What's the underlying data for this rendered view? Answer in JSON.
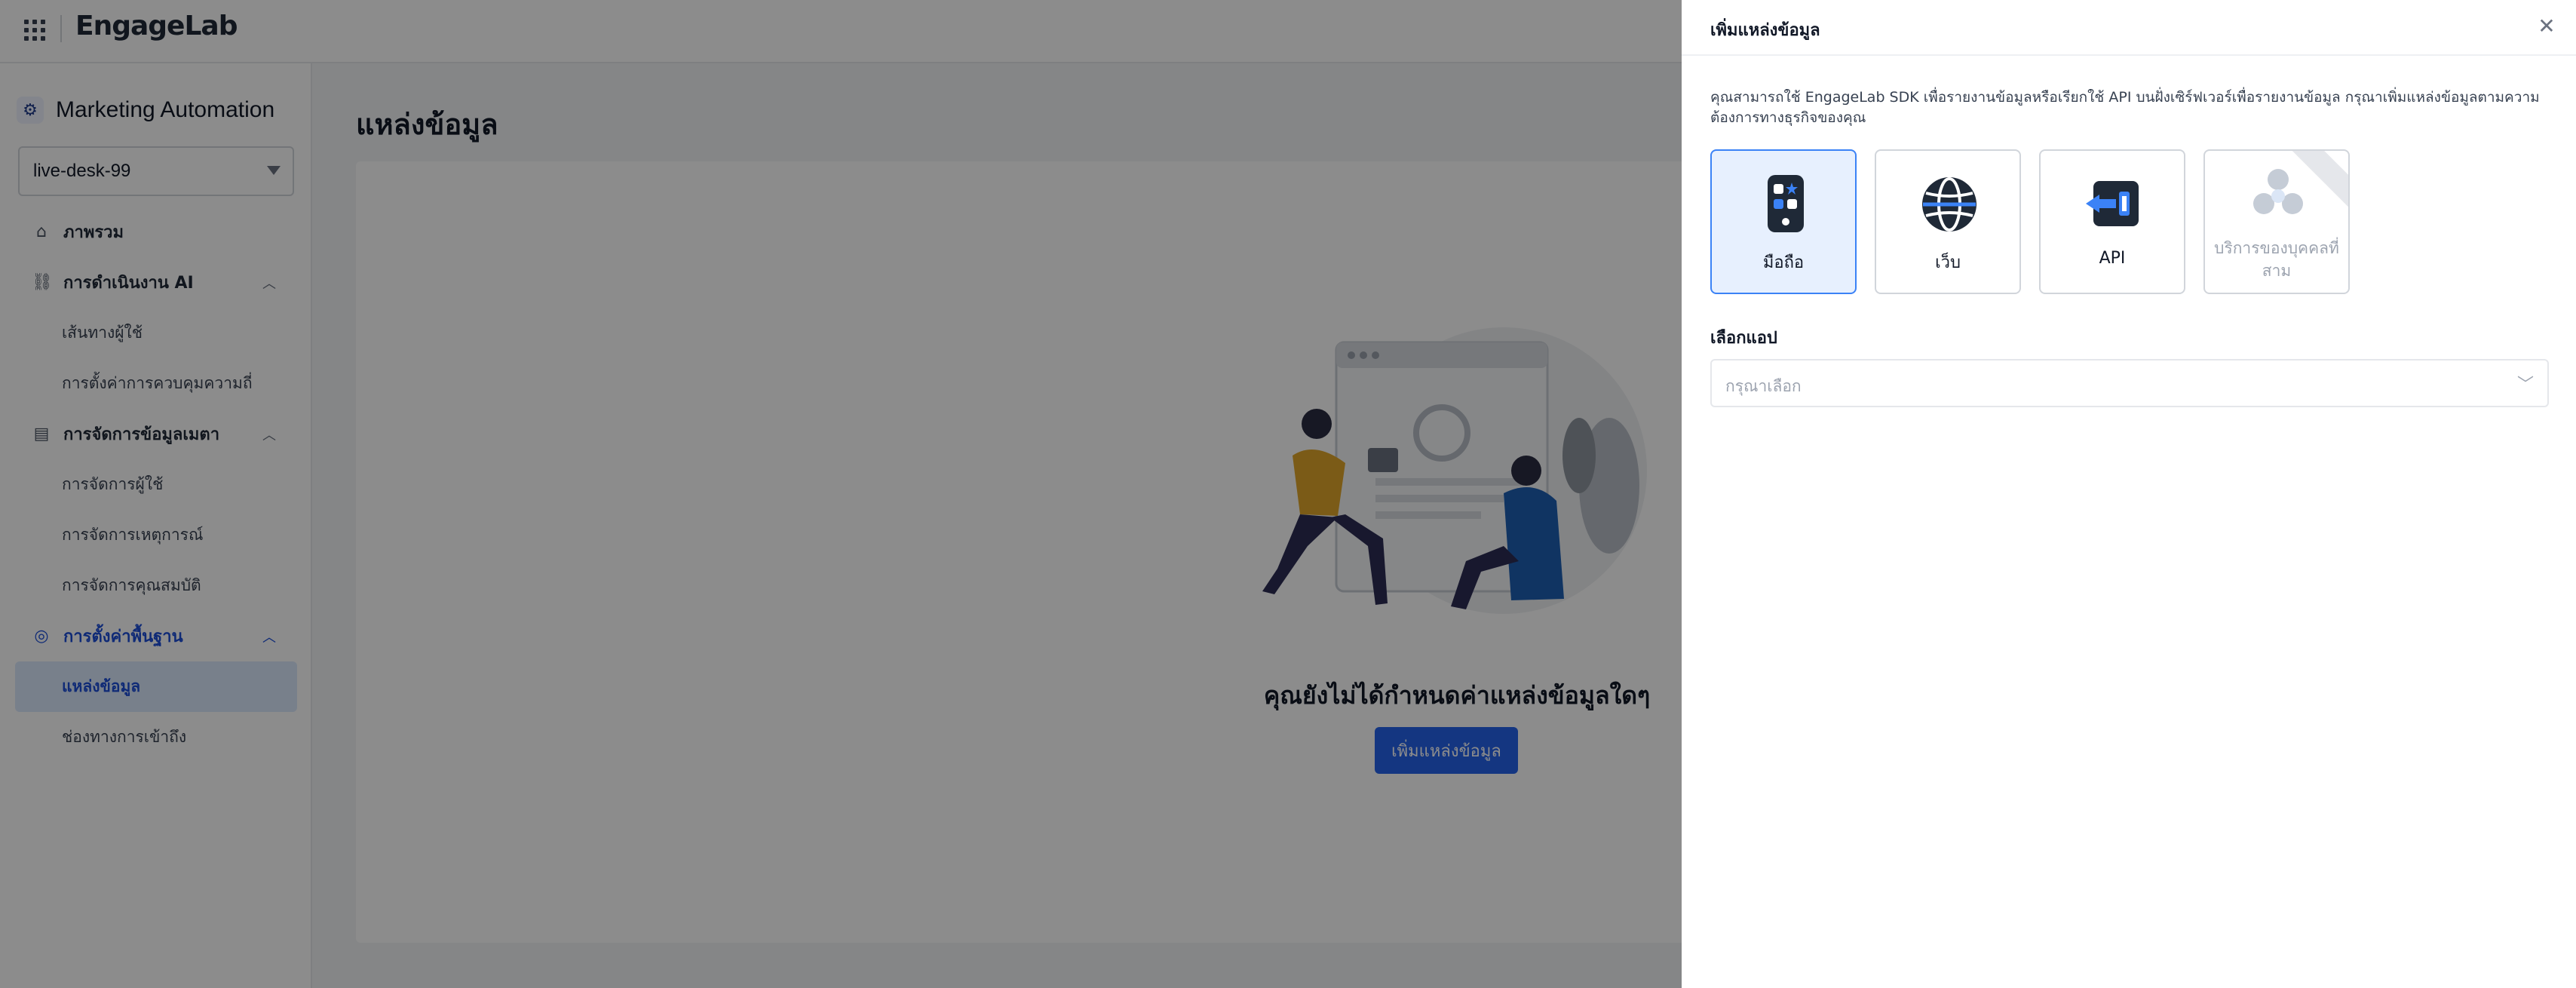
{
  "topbar": {
    "logo_text": "EngageLab"
  },
  "sidebar": {
    "product_title": "Marketing Automation",
    "project": "live-desk-99",
    "nav": [
      {
        "label": "ภาพรวม",
        "type": "item",
        "icon": "home-icon"
      },
      {
        "label": "การดำเนินงาน AI",
        "type": "group",
        "icon": "workflow-icon"
      },
      {
        "label": "เส้นทางผู้ใช้",
        "type": "sub"
      },
      {
        "label": "การตั้งค่าการควบคุมความถี่",
        "type": "sub"
      },
      {
        "label": "การจัดการข้อมูลเมตา",
        "type": "group",
        "icon": "metadata-icon"
      },
      {
        "label": "การจัดการผู้ใช้",
        "type": "sub"
      },
      {
        "label": "การจัดการเหตุการณ์",
        "type": "sub"
      },
      {
        "label": "การจัดการคุณสมบัติ",
        "type": "sub"
      },
      {
        "label": "การตั้งค่าพื้นฐาน",
        "type": "group",
        "icon": "settings-icon"
      },
      {
        "label": "แหล่งข้อมูล",
        "type": "sub",
        "active": true
      },
      {
        "label": "ช่องทางการเข้าถึง",
        "type": "sub"
      }
    ]
  },
  "main": {
    "page_title": "แหล่งข้อมูล",
    "empty_text": "คุณยังไม่ได้กำหนดค่าแหล่งข้อมูลใดๆ",
    "add_button": "เพิ่มแหล่งข้อมูล"
  },
  "drawer": {
    "title": "เพิ่มแหล่งข้อมูล",
    "description": "คุณสามารถใช้ EngageLab SDK เพื่อรายงานข้อมูลหรือเรียกใช้ API บนฝั่งเซิร์ฟเวอร์เพื่อรายงานข้อมูล กรุณาเพิ่มแหล่งข้อมูลตามความต้องการทางธุรกิจของคุณ",
    "types": [
      {
        "label": "มือถือ",
        "icon": "mobile-icon",
        "selected": true
      },
      {
        "label": "เว็บ",
        "icon": "web-icon",
        "selected": false
      },
      {
        "label": "API",
        "icon": "api-icon",
        "selected": false
      },
      {
        "label": "บริการของบุคคลที่สาม",
        "icon": "third-party-icon",
        "selected": false,
        "disabled": true
      }
    ],
    "app_label": "เลือกแอป",
    "app_placeholder": "กรุณาเลือก"
  },
  "colors": {
    "accent": "#2563eb",
    "selected_bg": "#e7f0fe",
    "overlay": "rgba(0,0,0,0.45)"
  }
}
